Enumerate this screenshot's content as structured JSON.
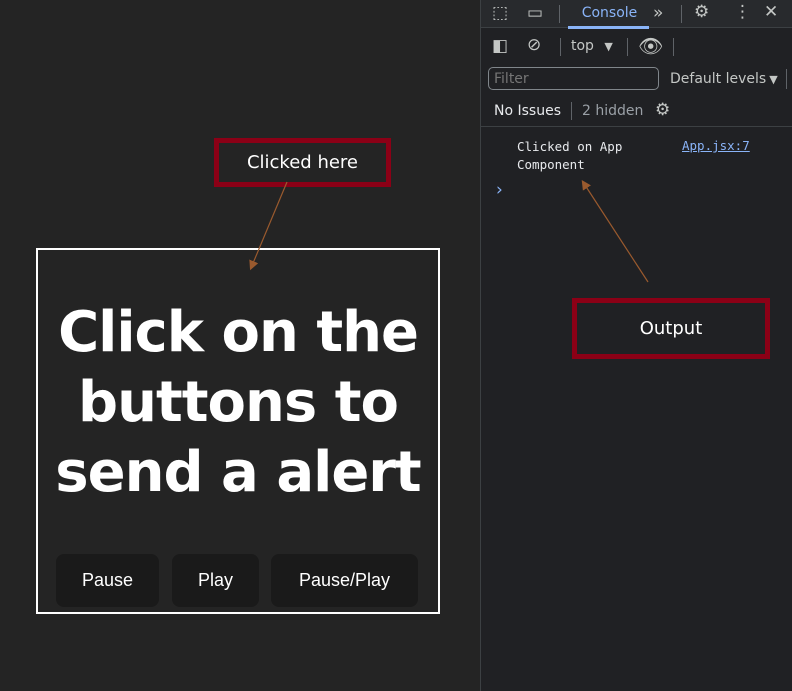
{
  "app": {
    "heading": "Click on the buttons to send a alert",
    "buttons": [
      "Pause",
      "Play",
      "Pause/Play"
    ]
  },
  "annotations": {
    "clicked": "Clicked here",
    "output": "Output",
    "box_color": "#8b0016",
    "arrow_color": "#9a5a2e"
  },
  "devtools": {
    "tabs": {
      "console": "Console"
    },
    "context": "top",
    "filter_placeholder": "Filter",
    "levels": "Default levels",
    "issues": "No Issues",
    "hidden": "2 hidden",
    "log": {
      "message_line1": "Clicked on App",
      "message_line2": "Component",
      "source": "App.jsx:7"
    },
    "prompt": "›"
  }
}
